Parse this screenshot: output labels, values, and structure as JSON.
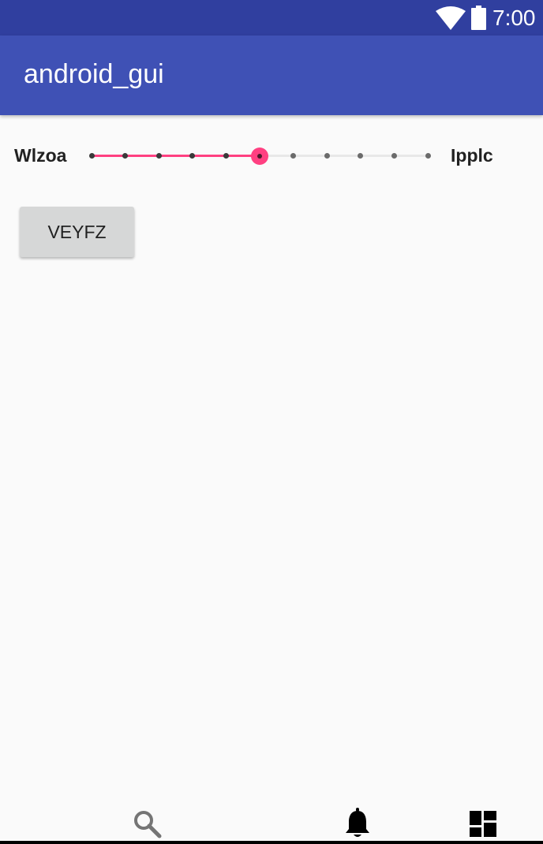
{
  "status_bar": {
    "time": "7:00",
    "icons": [
      "wifi-icon",
      "battery-icon"
    ]
  },
  "app_bar": {
    "title": "android_gui"
  },
  "slider": {
    "min_label": "Wlzoa",
    "max_label": "Ipplc",
    "steps": 10,
    "value": 5,
    "fraction": 0.5
  },
  "button": {
    "label": "VEYFZ"
  },
  "bottom_nav": {
    "icons": [
      "search-icon",
      "bell-icon",
      "dashboard-icon"
    ]
  },
  "colors": {
    "status_bar": "#303f9f",
    "app_bar": "#3f51b5",
    "accent": "#ff4081",
    "background": "#fafafa",
    "button": "#d6d7d7"
  }
}
